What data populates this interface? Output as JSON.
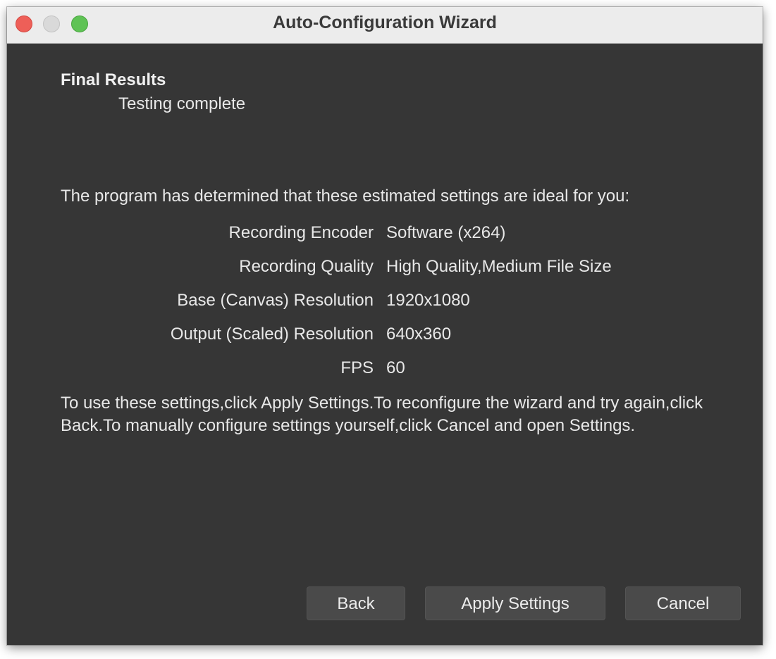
{
  "window": {
    "title": "Auto-Configuration Wizard",
    "traffic_lights": {
      "close_color": "#ee5f58",
      "minimize_color": "#d9d9d9",
      "zoom_color": "#5fc355"
    }
  },
  "header": {
    "title": "Final Results",
    "subtitle": "Testing complete"
  },
  "body": {
    "intro": "The program has determined that these estimated settings are ideal for you:",
    "settings": [
      {
        "label": "Recording Encoder",
        "value": "Software (x264)"
      },
      {
        "label": "Recording Quality",
        "value": "High Quality,Medium File Size"
      },
      {
        "label": "Base (Canvas) Resolution",
        "value": "1920x1080"
      },
      {
        "label": "Output (Scaled) Resolution",
        "value": "640x360"
      },
      {
        "label": "FPS",
        "value": "60"
      }
    ],
    "outro": "To use these settings,click Apply Settings.To reconfigure the wizard and try again,click Back.To manually configure settings yourself,click Cancel and open Settings."
  },
  "buttons": {
    "back_label": "Back",
    "apply_label": "Apply Settings",
    "cancel_label": "Cancel"
  },
  "colors": {
    "background": "#363636",
    "text": "#e8e8e8",
    "button": "#4a4a4a"
  }
}
